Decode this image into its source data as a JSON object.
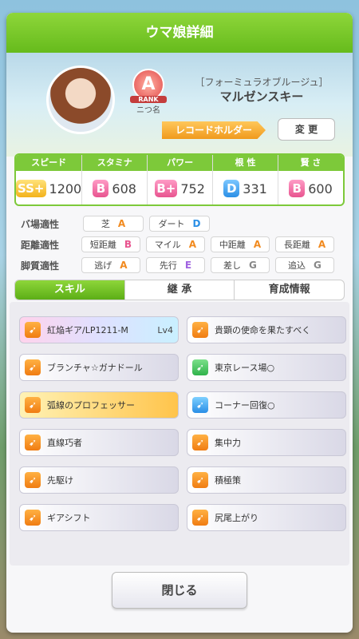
{
  "header": {
    "title": "ウマ娘詳細"
  },
  "profile": {
    "rank_letter": "A",
    "rank_word": "RANK",
    "rank_name": "ニつ名",
    "title": "［フォーミュラオブルージュ］",
    "name": "マルゼンスキー",
    "tag": "レコードホルダー",
    "change_label": "変 更"
  },
  "stats": [
    {
      "label": "スピード",
      "grade": "SS+",
      "value": "1200"
    },
    {
      "label": "スタミナ",
      "grade": "B",
      "value": "608"
    },
    {
      "label": "パワー",
      "grade": "B+",
      "value": "752"
    },
    {
      "label": "根 性",
      "grade": "D",
      "value": "331"
    },
    {
      "label": "賢 さ",
      "grade": "B",
      "value": "600"
    }
  ],
  "aptitude": {
    "rows": [
      {
        "head": "バ場適性",
        "cells": [
          {
            "k": "芝",
            "g": "A"
          },
          {
            "k": "ダート",
            "g": "D"
          }
        ]
      },
      {
        "head": "距離適性",
        "cells": [
          {
            "k": "短距離",
            "g": "B"
          },
          {
            "k": "マイル",
            "g": "A"
          },
          {
            "k": "中距離",
            "g": "A"
          },
          {
            "k": "長距離",
            "g": "A"
          }
        ]
      },
      {
        "head": "脚質適性",
        "cells": [
          {
            "k": "逃げ",
            "g": "A"
          },
          {
            "k": "先行",
            "g": "E"
          },
          {
            "k": "差し",
            "g": "G"
          },
          {
            "k": "追込",
            "g": "G"
          }
        ]
      }
    ]
  },
  "tabs": [
    "スキル",
    "継 承",
    "育成情報"
  ],
  "skills": {
    "left": [
      "紅焔ギア/LP1211-M",
      "ブランチャ☆ガナドール",
      "弧線のプロフェッサー",
      "直線巧者",
      "先駆け",
      "ギアシフト"
    ],
    "right": [
      "貴顕の使命を果たすべく",
      "東京レース場○",
      "コーナー回復○",
      "集中力",
      "積極策",
      "尻尾上がり"
    ],
    "level": "Lv4"
  },
  "close_label": "閉じる"
}
